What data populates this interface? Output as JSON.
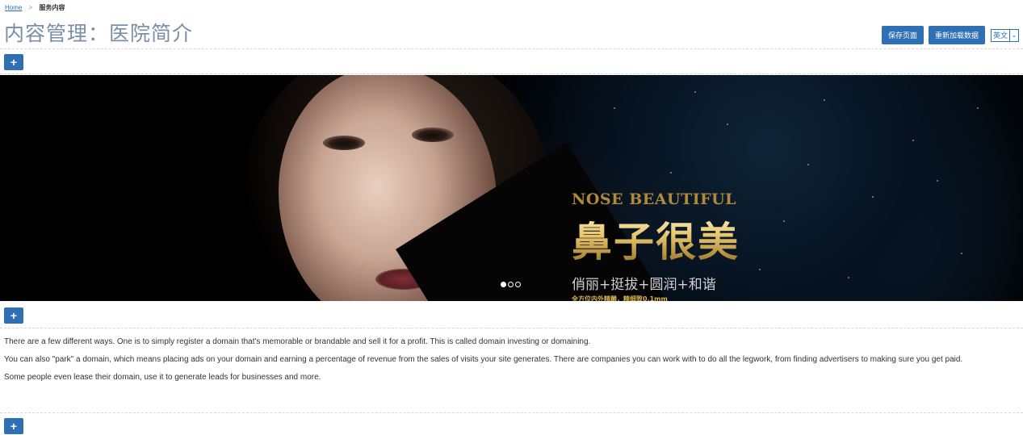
{
  "breadcrumb": {
    "home": "Home",
    "separator": ">",
    "current": "服务内容"
  },
  "page": {
    "title": "内容管理：医院简介"
  },
  "header": {
    "save_label": "保存页面",
    "reload_label": "重新加载数据",
    "language": {
      "selected": "英文",
      "arrow": "⌄"
    }
  },
  "add_button_label": "+",
  "banner": {
    "en_title": "NOSE BEAUTIFUL",
    "cn_title": "鼻子很美",
    "subtitle": "俏丽+挺拔+圆润+和谐",
    "note": "全方位内外精雕，精细致0.1mm",
    "slide_count": 3,
    "active_slide": 1
  },
  "content": {
    "paragraphs": [
      "There are a few different ways. One is to simply register a domain that's memorable or brandable and sell it for a profit. This is called domain investing or domaining.",
      "You can also \"park\" a domain, which means placing ads on your domain and earning a percentage of revenue from the sales of visits your site generates. There are companies you can work with to do all the legwork, from finding advertisers to making sure you get paid.",
      "Some people even lease their domain, use it to generate leads for businesses and more."
    ]
  },
  "colors": {
    "accent": "#2f6fb4",
    "title": "#7b8ea8",
    "gold": "#d9b34c"
  }
}
